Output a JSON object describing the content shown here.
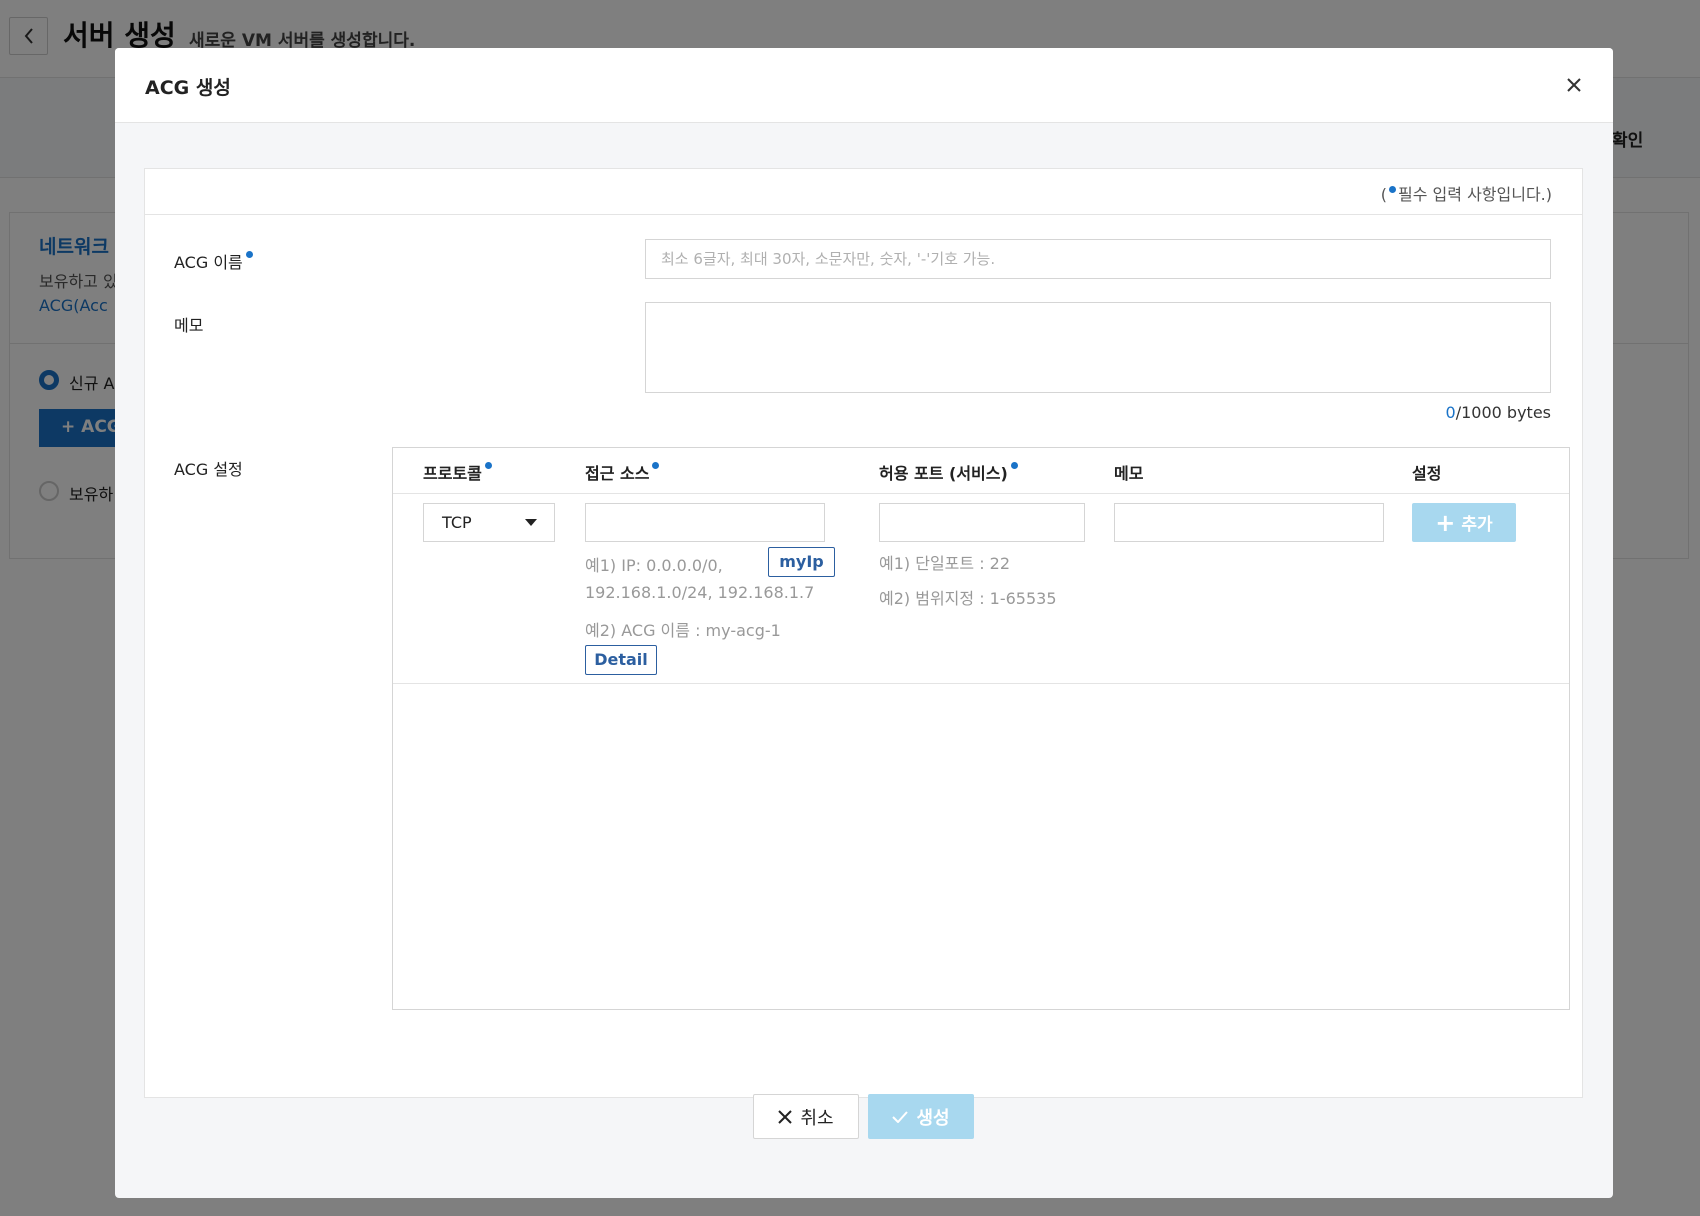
{
  "page": {
    "title": "서버 생성",
    "subtitle": "새로운 VM 서버를 생성합니다.",
    "step_confirm": "확인",
    "network_title": "네트워크 ",
    "network_desc": "보유하고 있",
    "network_link": "ACG(Acc",
    "radio_new": "신규 A",
    "add_acg": "+ ACG",
    "radio_existing": "보유하"
  },
  "modal": {
    "title": "ACG 생성",
    "required_note_prefix": "(",
    "required_note": "필수 입력 사항입니다.)",
    "name_label": "ACG 이름",
    "name_placeholder": "최소 6글자, 최대 30자, 소문자만, 숫자, '-'기호 가능.",
    "name_value": "",
    "memo_label": "메모",
    "memo_value": "",
    "byte_current": "0",
    "byte_total": "/1000 bytes",
    "acg_settings_label": "ACG 설정",
    "table": {
      "col_protocol": "프로토콜",
      "col_source": "접근 소스",
      "col_port": "허용 포트 (서비스)",
      "col_memo": "메모",
      "col_setting": "설정",
      "protocol_value": "TCP",
      "source_value": "",
      "myip_button": "myIp",
      "source_hint_1": "예1) IP: 0.0.0.0/0,",
      "source_hint_2": "192.168.1.0/24, 192.168.1.7",
      "source_hint_3": "예2) ACG 이름 : my-acg-1",
      "detail_button": "Detail",
      "port_value": "",
      "port_hint_1": "예1) 단일포트 : 22",
      "port_hint_2": "예2) 범위지정 : 1-65535",
      "memo_value": "",
      "add_button": "추가"
    },
    "cancel_button": "취소",
    "create_button": "생성"
  },
  "colors": {
    "accent": "#1a73c8",
    "disabled_button": "#a8d8ef",
    "outline_button": "#2c5fa0"
  },
  "icons": [
    "chevron-left-icon",
    "close-icon",
    "dropdown-caret-icon",
    "plus-icon",
    "x-icon",
    "check-icon"
  ]
}
